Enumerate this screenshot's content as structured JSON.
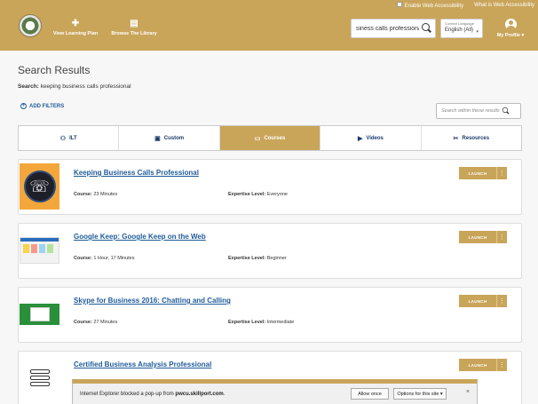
{
  "header": {
    "accessibility_label": "Enable Web Accessibility",
    "what_is_label": "What is Web Accessibility",
    "nav": [
      {
        "label": "View Learning Plan",
        "icon": "puzzle-icon"
      },
      {
        "label": "Browse The Library",
        "icon": "book-icon"
      }
    ],
    "search_value": "siness calls professional",
    "language": {
      "label": "Content Language",
      "value": "English (All)"
    },
    "profile_label": "My Profile ▾"
  },
  "main": {
    "title": "Search Results",
    "search_prefix": "Search:",
    "search_query": "keeping business calls professional",
    "add_filters": "ADD FILTERS",
    "within_placeholder": "Search within these results",
    "tabs": [
      {
        "label": "ILT",
        "icon": "person-icon"
      },
      {
        "label": "Custom",
        "icon": "clipboard-icon"
      },
      {
        "label": "Courses",
        "icon": "course-icon",
        "active": true
      },
      {
        "label": "Videos",
        "icon": "video-icon"
      },
      {
        "label": "Resources",
        "icon": "tools-icon"
      }
    ],
    "results": [
      {
        "title": "Keeping Business Calls Professional",
        "course_label": "Course:",
        "course_value": "23 Minutes",
        "level_label": "Expertise Level:",
        "level_value": "Everyone",
        "launch": "LAUNCH"
      },
      {
        "title": "Google Keep: Google Keep on the Web",
        "course_label": "Course:",
        "course_value": "1 Hour, 17 Minutes",
        "level_label": "Expertise Level:",
        "level_value": "Beginner",
        "launch": "LAUNCH"
      },
      {
        "title": "Skype for Business 2016: Chatting and Calling",
        "course_label": "Course:",
        "course_value": "27 Minutes",
        "level_label": "Expertise Level:",
        "level_value": "Intermediate",
        "launch": "LAUNCH"
      },
      {
        "title": "Certified Business Analysis Professional",
        "launch": "LAUNCH"
      }
    ]
  },
  "popup": {
    "message_prefix": "Internet Explorer blocked a pop-up from",
    "site": "pwcu.skillport.com",
    "allow_once": "Allow once",
    "options": "Options for this site ▾",
    "close": "×"
  },
  "colors": {
    "brand": "#c9a55a",
    "link": "#1e5b9a"
  }
}
